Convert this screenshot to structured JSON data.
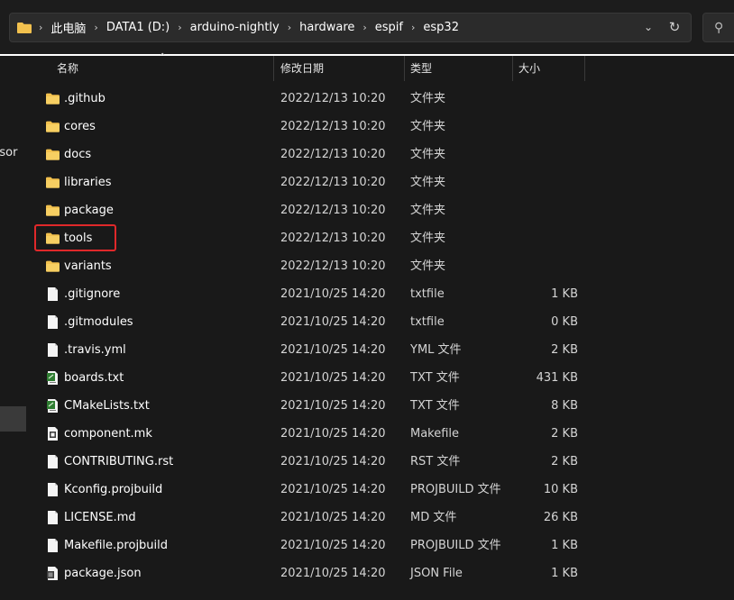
{
  "address_bar": {
    "breadcrumbs": [
      "此电脑",
      "DATA1 (D:)",
      "arduino-nightly",
      "hardware",
      "espif",
      "esp32"
    ]
  },
  "left_pane": {
    "partial_labels": [
      "ersor",
      ":)"
    ]
  },
  "columns": {
    "name": "名称",
    "date": "修改日期",
    "type": "类型",
    "size": "大小"
  },
  "files": [
    {
      "name": ".github",
      "date": "2022/12/13 10:20",
      "type": "文件夹",
      "size": "",
      "icon": "folder-icon"
    },
    {
      "name": "cores",
      "date": "2022/12/13 10:20",
      "type": "文件夹",
      "size": "",
      "icon": "folder-icon"
    },
    {
      "name": "docs",
      "date": "2022/12/13 10:20",
      "type": "文件夹",
      "size": "",
      "icon": "folder-icon"
    },
    {
      "name": "libraries",
      "date": "2022/12/13 10:20",
      "type": "文件夹",
      "size": "",
      "icon": "folder-icon"
    },
    {
      "name": "package",
      "date": "2022/12/13 10:20",
      "type": "文件夹",
      "size": "",
      "icon": "folder-icon"
    },
    {
      "name": "tools",
      "date": "2022/12/13 10:20",
      "type": "文件夹",
      "size": "",
      "icon": "folder-icon"
    },
    {
      "name": "variants",
      "date": "2022/12/13 10:20",
      "type": "文件夹",
      "size": "",
      "icon": "folder-icon"
    },
    {
      "name": ".gitignore",
      "date": "2021/10/25 14:20",
      "type": "txtfile",
      "size": "1 KB",
      "icon": "file-icon"
    },
    {
      "name": ".gitmodules",
      "date": "2021/10/25 14:20",
      "type": "txtfile",
      "size": "0 KB",
      "icon": "file-icon"
    },
    {
      "name": ".travis.yml",
      "date": "2021/10/25 14:20",
      "type": "YML 文件",
      "size": "2 KB",
      "icon": "file-icon"
    },
    {
      "name": "boards.txt",
      "date": "2021/10/25 14:20",
      "type": "TXT 文件",
      "size": "431 KB",
      "icon": "text-file-icon"
    },
    {
      "name": "CMakeLists.txt",
      "date": "2021/10/25 14:20",
      "type": "TXT 文件",
      "size": "8 KB",
      "icon": "text-file-icon"
    },
    {
      "name": "component.mk",
      "date": "2021/10/25 14:20",
      "type": "Makefile",
      "size": "2 KB",
      "icon": "makefile-icon"
    },
    {
      "name": "CONTRIBUTING.rst",
      "date": "2021/10/25 14:20",
      "type": "RST 文件",
      "size": "2 KB",
      "icon": "file-icon"
    },
    {
      "name": "Kconfig.projbuild",
      "date": "2021/10/25 14:20",
      "type": "PROJBUILD 文件",
      "size": "10 KB",
      "icon": "file-icon"
    },
    {
      "name": "LICENSE.md",
      "date": "2021/10/25 14:20",
      "type": "MD 文件",
      "size": "26 KB",
      "icon": "file-icon"
    },
    {
      "name": "Makefile.projbuild",
      "date": "2021/10/25 14:20",
      "type": "PROJBUILD 文件",
      "size": "1 KB",
      "icon": "file-icon"
    },
    {
      "name": "package.json",
      "date": "2021/10/25 14:20",
      "type": "JSON File",
      "size": "1 KB",
      "icon": "json-file-icon"
    }
  ],
  "highlighted_item": "tools",
  "colors": {
    "background": "#191919",
    "highlight": "#e0282a",
    "folder": "#f2c14e"
  }
}
